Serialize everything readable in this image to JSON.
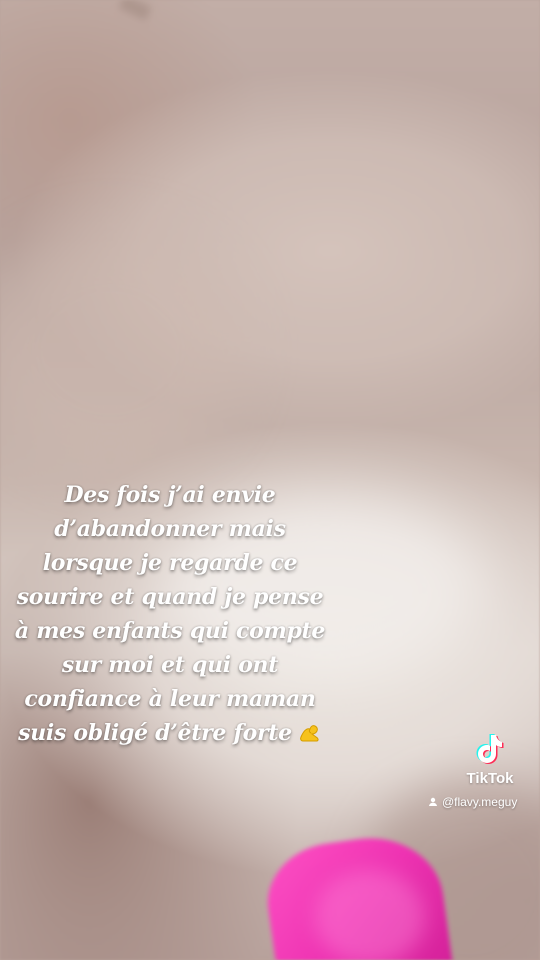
{
  "caption": {
    "lines": [
      "Des fois j’ai envie",
      "d’abandonner mais",
      "lorsque je regarde ce",
      "sourire et quand je pense",
      "à mes enfants qui compte",
      "sur moi et qui ont",
      "confiance à leur maman",
      "suis obligé d’être forte"
    ],
    "emoji": "flexed-biceps-icon"
  },
  "watermark": {
    "brand": "TikTok",
    "username": "@flavy.meguy",
    "logo_icon": "tiktok-logo-icon",
    "user_icon": "user-icon"
  },
  "colors": {
    "caption_text": "#ffffff",
    "pink_cloth": "#f031b3",
    "tiktok_cyan": "#25f4ee",
    "tiktok_red": "#fe2c55"
  }
}
